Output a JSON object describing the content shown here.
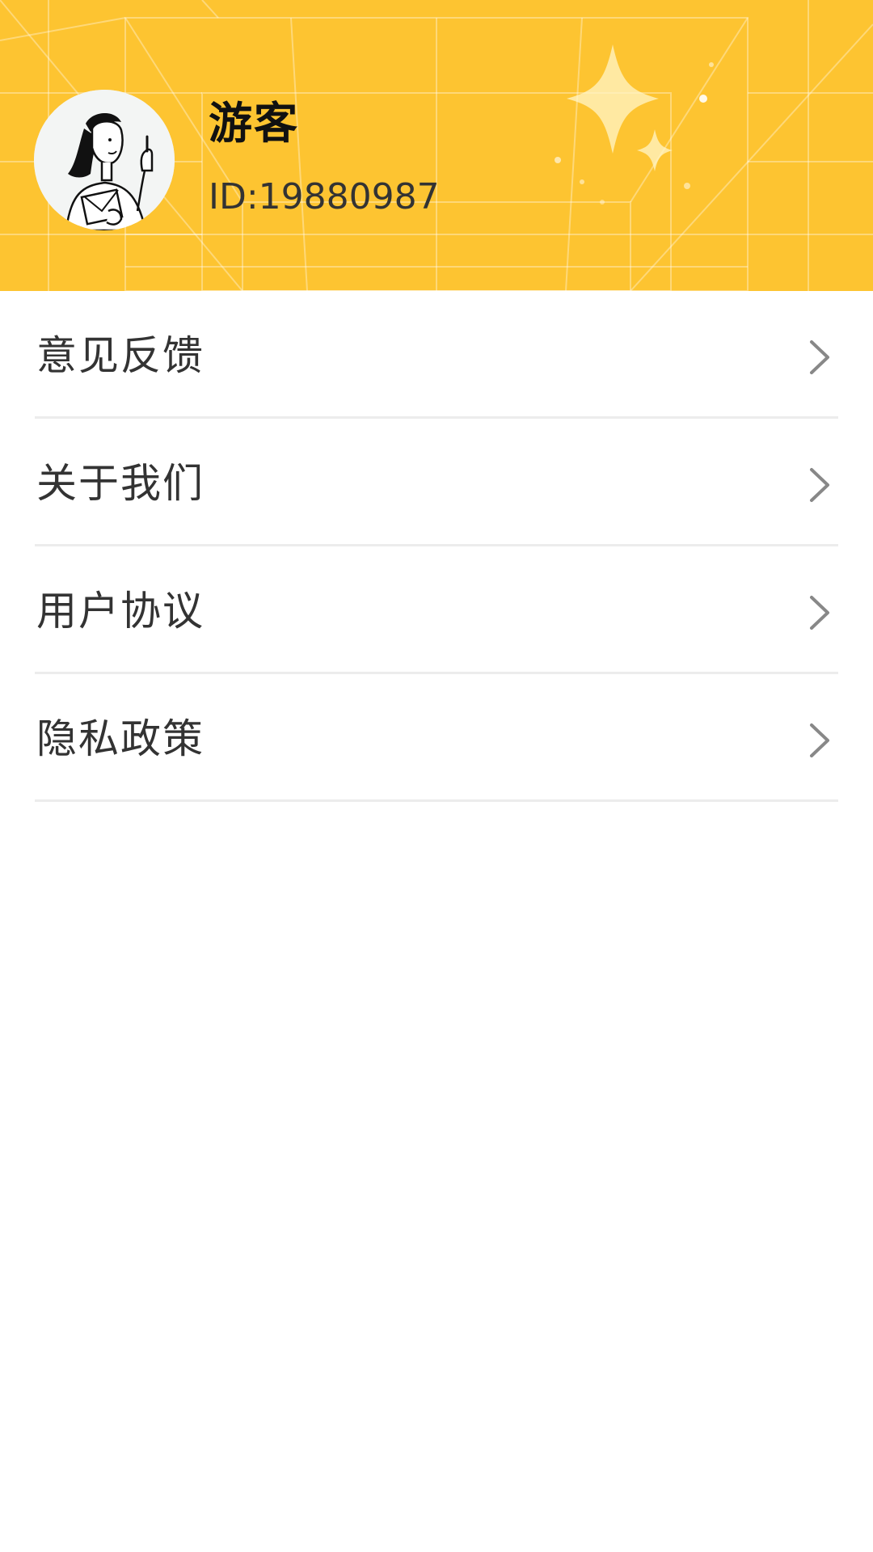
{
  "profile": {
    "name": "游客",
    "id_text": "ID:19880987",
    "avatar_icon": "person-pointing-avatar-icon"
  },
  "menu": {
    "items": [
      {
        "label": "意见反馈",
        "icon": "chevron-right-icon"
      },
      {
        "label": "关于我们",
        "icon": "chevron-right-icon"
      },
      {
        "label": "用户协议",
        "icon": "chevron-right-icon"
      },
      {
        "label": "隐私政策",
        "icon": "chevron-right-icon"
      }
    ]
  },
  "colors": {
    "header_bg": "#fdc431",
    "text_primary": "#333333",
    "divider": "#ececec",
    "chevron": "#888888"
  }
}
